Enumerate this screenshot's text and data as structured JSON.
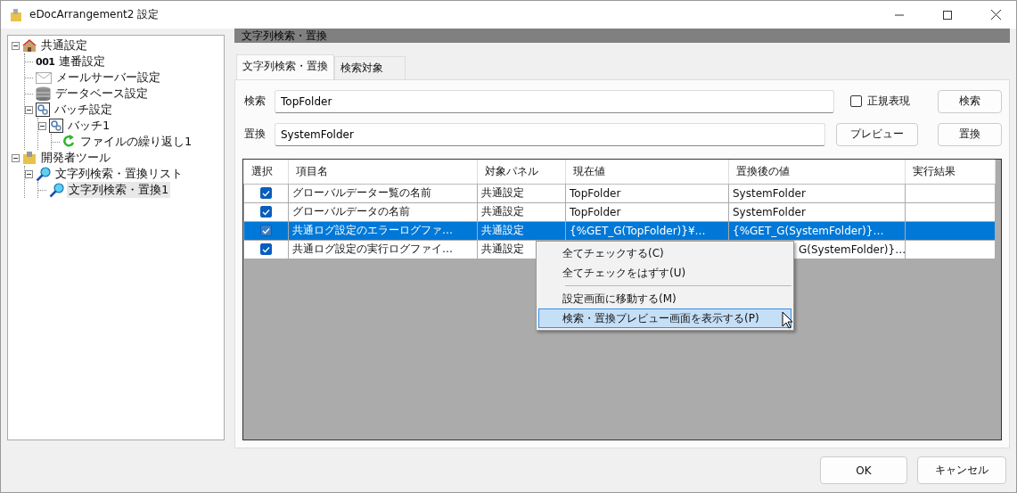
{
  "window": {
    "title": "eDocArrangement2 設定"
  },
  "tree": [
    {
      "label": "共通設定",
      "kind": "house",
      "expanded": true,
      "selected": false,
      "children": [
        {
          "label": "連番設定",
          "kind": "number",
          "prefix": "001",
          "selected": false
        },
        {
          "label": "メールサーバー設定",
          "kind": "mail",
          "selected": false
        },
        {
          "label": "データベース設定",
          "kind": "database",
          "selected": false
        },
        {
          "label": "バッチ設定",
          "kind": "batch",
          "expanded": true,
          "selected": false,
          "children": [
            {
              "label": "バッチ1",
              "kind": "batch",
              "expanded": true,
              "selected": false,
              "children": [
                {
                  "label": "ファイルの繰り返し1",
                  "kind": "loop",
                  "selected": false
                }
              ]
            }
          ]
        }
      ]
    },
    {
      "label": "開発者ツール",
      "kind": "folder",
      "expanded": true,
      "selected": false,
      "children": [
        {
          "label": "文字列検索・置換リスト",
          "kind": "search",
          "expanded": true,
          "selected": false,
          "children": [
            {
              "label": "文字列検索・置換1",
              "kind": "search",
              "selected": true
            }
          ]
        }
      ]
    }
  ],
  "panel_title": "文字列検索・置換",
  "tabs": [
    {
      "label": "文字列検索・置換",
      "selected": true
    },
    {
      "label": "検索対象",
      "selected": false
    }
  ],
  "search": {
    "label": "検索",
    "value": "TopFolder",
    "regex_label": "正規表現",
    "regex_checked": false,
    "button": "検索"
  },
  "replace": {
    "label": "置換",
    "value": "SystemFolder",
    "preview_button": "プレビュー",
    "button": "置換"
  },
  "table": {
    "columns": [
      "選択",
      "項目名",
      "対象パネル",
      "現在値",
      "置換後の値",
      "実行結果"
    ],
    "rows": [
      {
        "checked": true,
        "selected": false,
        "name": "グローバルデーター覧の名前",
        "panel": "共通設定",
        "current": "TopFolder",
        "replaced": "SystemFolder"
      },
      {
        "checked": true,
        "selected": false,
        "name": "グローバルデータの名前",
        "panel": "共通設定",
        "current": "TopFolder",
        "replaced": "SystemFolder"
      },
      {
        "checked": true,
        "selected": true,
        "name": "共通ログ設定のエラーログファ…",
        "panel": "共通設定",
        "current": "{%GET_G(TopFolder)}¥…",
        "replaced": "{%GET_G(SystemFolder)}…"
      },
      {
        "checked": true,
        "selected": false,
        "name": "共通ログ設定の実行ログファイ…",
        "panel": "共通設定",
        "replaced": "G(SystemFolder)}…"
      }
    ]
  },
  "context_menu": [
    {
      "label": "全てチェックする(C)",
      "selected": false,
      "separator_before": false
    },
    {
      "label": "全てチェックをはずす(U)",
      "selected": false,
      "separator_before": false
    },
    {
      "label": "設定画面に移動する(M)",
      "selected": false,
      "separator_before": true
    },
    {
      "label": "検索・置換プレビュー画面を表示する(P)",
      "selected": true,
      "separator_before": false
    }
  ],
  "buttons": {
    "ok": "OK",
    "cancel": "キャンセル"
  }
}
